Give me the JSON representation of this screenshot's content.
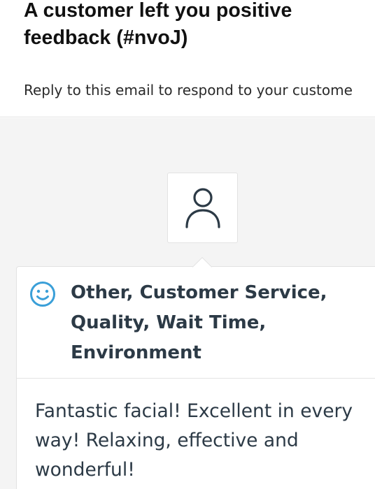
{
  "email": {
    "subject": "A customer left you positive feedback (#nvoJ)",
    "preheader": "Reply to this email to respond to your custome"
  },
  "feedback": {
    "avatar_icon": "person-outline-icon",
    "sentiment_icon": "smiley-face-icon",
    "sentiment_color": "#3a9fd8",
    "categories": "Other, Customer Service, Quality, Wait Time, Environment",
    "comment": "Fantastic facial! Excellent in every way! Relaxing, effective and wonderful!"
  }
}
